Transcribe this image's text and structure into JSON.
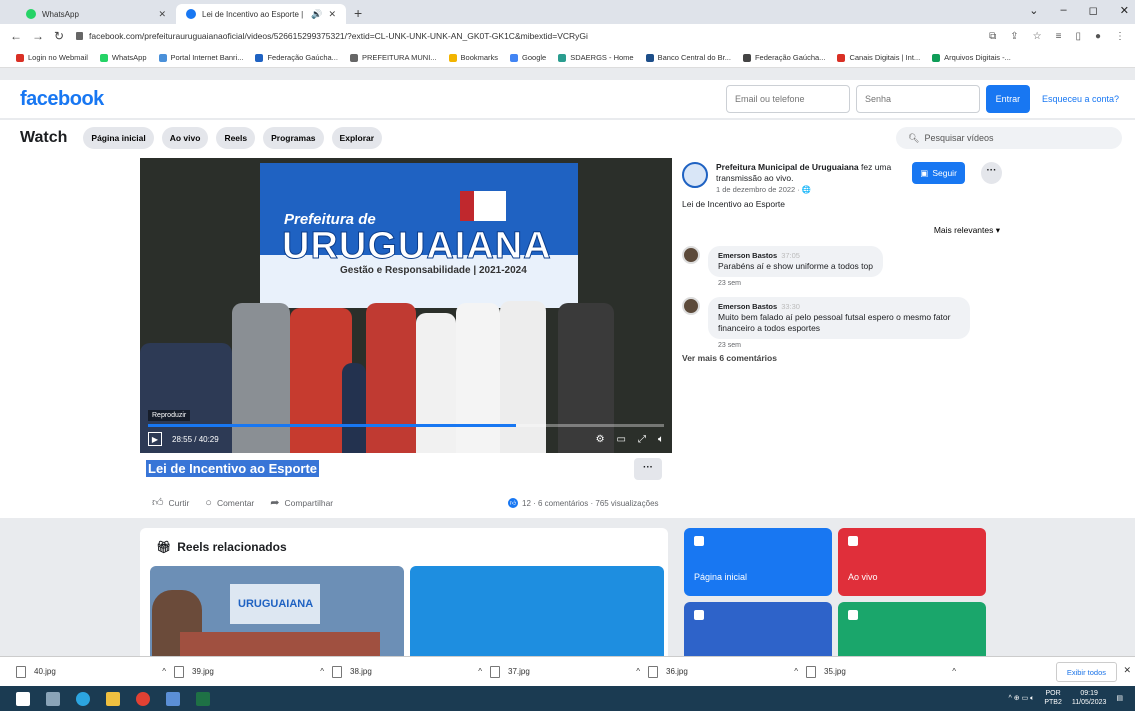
{
  "browser": {
    "tabs": [
      {
        "title": "WhatsApp",
        "color": "#25d366"
      },
      {
        "title": "Lei de Incentivo ao Esporte |",
        "color": "#1877f2",
        "audio": "🔊"
      }
    ],
    "url": "facebook.com/prefeiturauruguaianaoficial/videos/526615299375321/?extid=CL-UNK-UNK-UNK-AN_GK0T-GK1C&mibextid=VCRyGi",
    "bookmarks": [
      {
        "label": "Login no Webmail",
        "color": "#d93025"
      },
      {
        "label": "WhatsApp",
        "color": "#25d366"
      },
      {
        "label": "Portal Internet Banri...",
        "color": "#4a90d9"
      },
      {
        "label": "Federação Gaúcha...",
        "color": "#1f62c2"
      },
      {
        "label": "PREFEITURA MUNI...",
        "color": "#666666"
      },
      {
        "label": "Bookmarks",
        "color": "#f2b400"
      },
      {
        "label": "Google",
        "color": "#4285f4"
      },
      {
        "label": "SDAERGS - Home",
        "color": "#2a9d8f"
      },
      {
        "label": "Banco Central do Br...",
        "color": "#1d4e89"
      },
      {
        "label": "Federação Gaúcha...",
        "color": "#444444"
      },
      {
        "label": "Canais Digitais | Int...",
        "color": "#d93025"
      },
      {
        "label": "Arquivos Digitais -...",
        "color": "#0f9d58"
      }
    ]
  },
  "fb": {
    "logo": "facebook",
    "email_placeholder": "Email ou telefone",
    "password_placeholder": "Senha",
    "login_button": "Entrar",
    "forgot": "Esqueceu a conta?"
  },
  "watch": {
    "title": "Watch",
    "nav": [
      "Página inicial",
      "Ao vivo",
      "Reels",
      "Programas",
      "Explorar"
    ],
    "search_placeholder": "Pesquisar vídeos"
  },
  "video": {
    "banner_pref": "Prefeitura de",
    "banner_city": "URUGUAIANA",
    "banner_gestao": "Gestão e Responsabilidade | 2021-2024",
    "play_label": "Reproduzir",
    "time": "28:55 / 40:29",
    "progress": 0.714,
    "title": "Lei de Incentivo ao Esporte",
    "actions": {
      "like": "Curtir",
      "comment": "Comentar",
      "share": "Compartilhar"
    },
    "stats": "12 · 6 comentários · 765 visualizações"
  },
  "page": {
    "name": "Prefeitura Municipal de Uruguaiana",
    "action": " fez uma transmissão ao vivo.",
    "date": "1 de dezembro de 2022 · 🌐",
    "follow": "Seguir",
    "description": "Lei de Incentivo ao Esporte",
    "sort": "Mais relevantes ▾"
  },
  "comments": [
    {
      "author": "Emerson Bastos",
      "time": "37:05",
      "text": "Parabéns aí e show uniforme a todos top",
      "age": "23 sem"
    },
    {
      "author": "Emerson Bastos",
      "time": "33:30",
      "text": "Muito bem falado aí pelo pessoal futsal espero o mesmo fator financeiro a todos esportes",
      "age": "23 sem"
    }
  ],
  "see_more": "Ver mais 6 comentários",
  "reels": {
    "title": "Reels relacionados",
    "thumb_text": "URUGUAIANA"
  },
  "tiles": [
    {
      "label": "Página inicial",
      "color": "#1877f2"
    },
    {
      "label": "Ao vivo",
      "color": "#e02f3a"
    },
    {
      "label": "",
      "color": "#2e63c9"
    },
    {
      "label": "",
      "color": "#1aa66b"
    }
  ],
  "downloads": [
    "40.jpg",
    "39.jpg",
    "38.jpg",
    "37.jpg",
    "36.jpg",
    "35.jpg"
  ],
  "downloads_show_all": "Exibir todos",
  "taskbar": {
    "lang": "POR",
    "lang2": "PTB2",
    "time": "09:19",
    "date": "11/05/2023"
  }
}
